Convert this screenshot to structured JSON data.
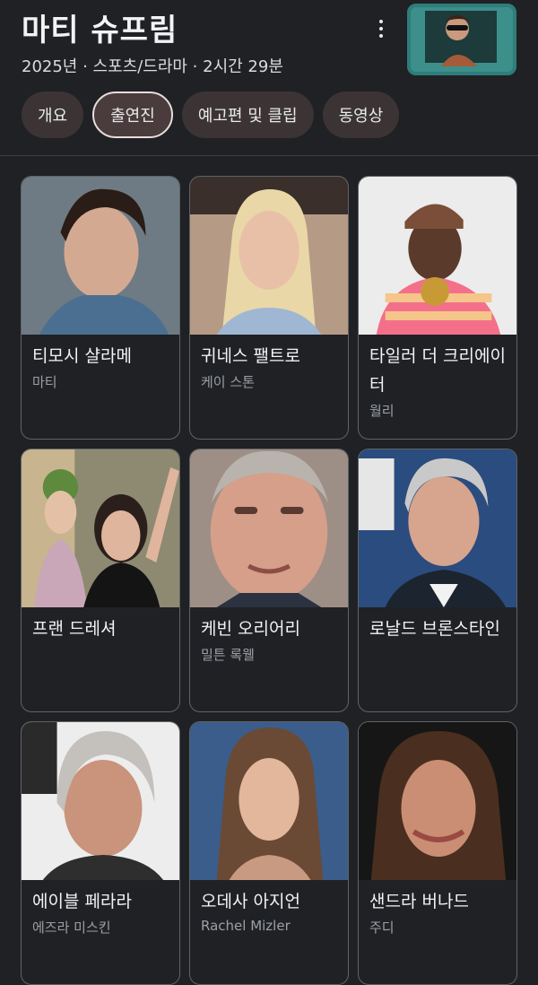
{
  "header": {
    "title": "마티 슈프림",
    "subtitle": "2025년 · 스포츠/드라마 · 2시간 29분",
    "more_icon": "more-vert-icon"
  },
  "tabs": [
    {
      "label": "개요",
      "active": false
    },
    {
      "label": "출연진",
      "active": true
    },
    {
      "label": "예고편 및 클립",
      "active": false
    },
    {
      "label": "동영상",
      "active": false
    }
  ],
  "cast": [
    {
      "name": "티모시 샬라메",
      "role": "마티"
    },
    {
      "name": "귀네스 팰트로",
      "role": "케이 스톤"
    },
    {
      "name": "타일러 더 크리에이터",
      "role": "월리"
    },
    {
      "name": "프랜 드레셔",
      "role": ""
    },
    {
      "name": "케빈 오리어리",
      "role": "밀튼 록웰"
    },
    {
      "name": "로날드 브론스타인",
      "role": ""
    },
    {
      "name": "에이블 페라라",
      "role": "에즈라 미스킨"
    },
    {
      "name": "오데사 아지언",
      "role": "Rachel Mizler"
    },
    {
      "name": "샌드라 버나드",
      "role": "주디"
    }
  ]
}
